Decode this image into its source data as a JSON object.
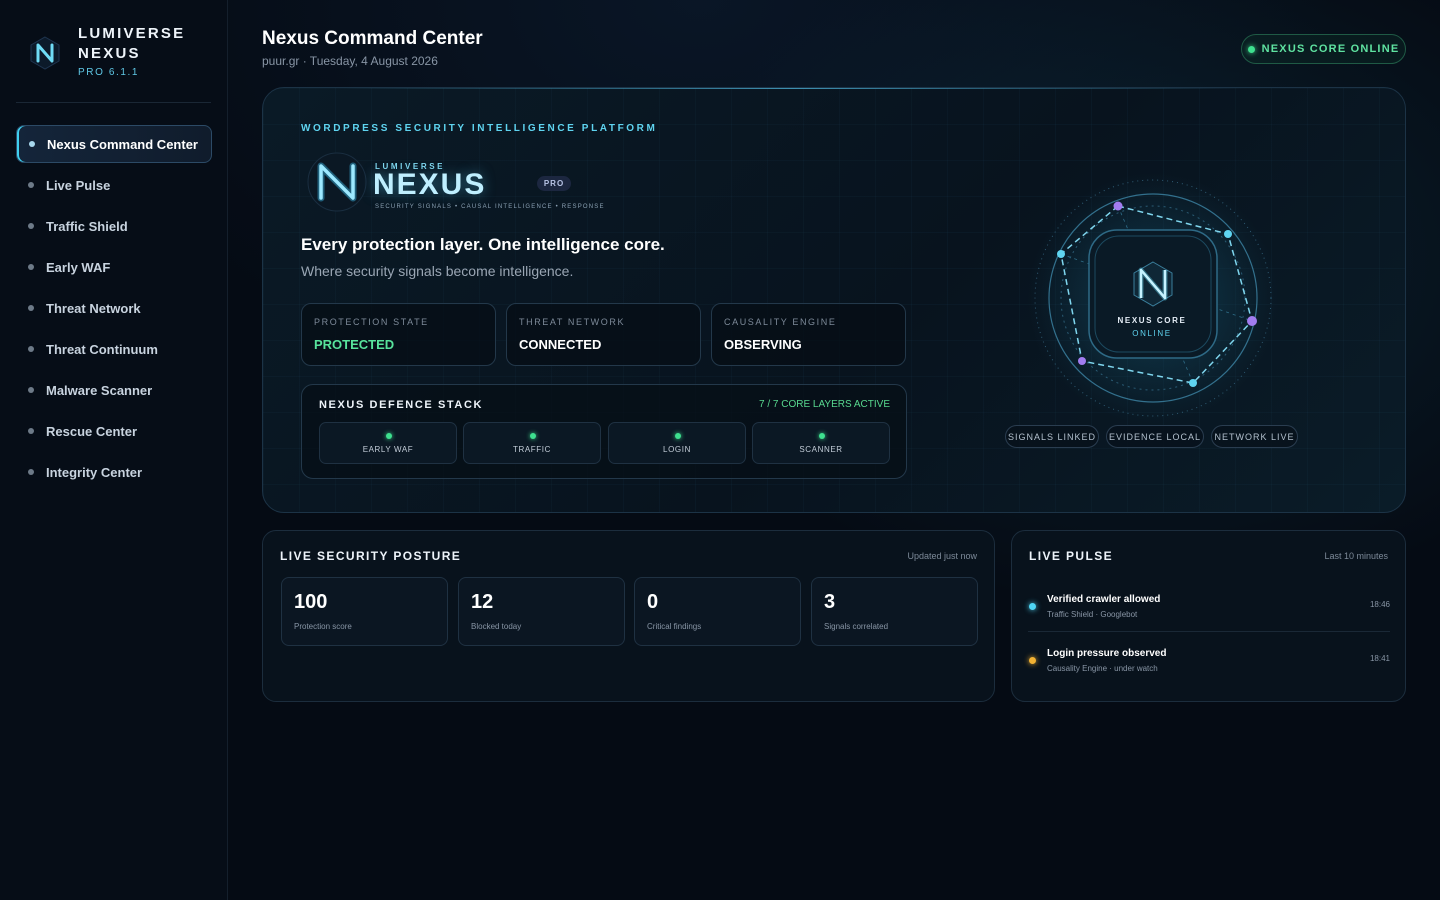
{
  "brand": {
    "name_line1": "LUMIVERSE",
    "name_line2": "NEXUS",
    "version": "PRO 6.1.1"
  },
  "sidebar": {
    "items": [
      {
        "label": "Nexus Command Center",
        "active": true
      },
      {
        "label": "Live Pulse"
      },
      {
        "label": "Traffic Shield"
      },
      {
        "label": "Early WAF"
      },
      {
        "label": "Threat Network"
      },
      {
        "label": "Threat Continuum"
      },
      {
        "label": "Malware Scanner"
      },
      {
        "label": "Rescue Center"
      },
      {
        "label": "Integrity Center"
      }
    ]
  },
  "header": {
    "title": "Nexus Command Center",
    "subtitle": "puur.gr · Tuesday, 4 August 2026",
    "status": "NEXUS CORE ONLINE"
  },
  "hero": {
    "eyebrow": "WORDPRESS SECURITY INTELLIGENCE PLATFORM",
    "wordmark_small": "LUMIVERSE",
    "wordmark_big": "NEXUS",
    "wordmark_tag": "SECURITY SIGNALS • CAUSAL INTELLIGENCE • RESPONSE",
    "pro_badge": "PRO",
    "headline": "Every protection layer. One intelligence core.",
    "subline": "Where security signals become intelligence.",
    "states": [
      {
        "key": "PROTECTION STATE",
        "value": "PROTECTED"
      },
      {
        "key": "THREAT NETWORK",
        "value": "CONNECTED"
      },
      {
        "key": "CAUSALITY ENGINE",
        "value": "OBSERVING"
      }
    ],
    "stack": {
      "title": "NEXUS DEFENCE STACK",
      "count": "7 / 7 CORE LAYERS ACTIVE",
      "layers": [
        "EARLY WAF",
        "TRAFFIC",
        "LOGIN",
        "SCANNER"
      ]
    },
    "core": {
      "label": "NEXUS CORE",
      "status": "ONLINE"
    },
    "chips": [
      "SIGNALS LINKED",
      "EVIDENCE LOCAL",
      "NETWORK LIVE"
    ]
  },
  "posture": {
    "title": "LIVE SECURITY POSTURE",
    "meta": "Updated just now",
    "metrics": [
      {
        "value": "100",
        "label": "Protection score"
      },
      {
        "value": "12",
        "label": "Blocked today"
      },
      {
        "value": "0",
        "label": "Critical findings"
      },
      {
        "value": "3",
        "label": "Signals correlated"
      }
    ]
  },
  "pulse": {
    "title": "LIVE PULSE",
    "meta": "Last 10 minutes",
    "events": [
      {
        "title": "Verified crawler allowed",
        "source": "Traffic Shield · Googlebot",
        "time": "18:46",
        "color": "#4fd6f5"
      },
      {
        "title": "Login pressure observed",
        "source": "Causality Engine · under watch",
        "time": "18:41",
        "color": "#f2b233"
      }
    ]
  },
  "colors": {
    "accent": "#5fd4f0",
    "success": "#58e39c",
    "warning": "#f2b233",
    "violet": "#a17cf0"
  },
  "icons": [
    "nexus-logo-icon",
    "status-dot-icon"
  ]
}
